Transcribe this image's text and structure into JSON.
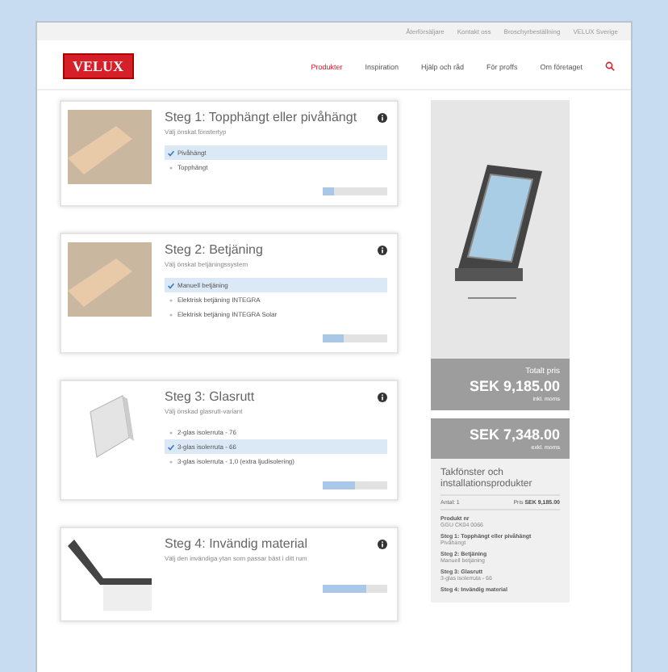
{
  "utility_links": [
    "Återförsäljare",
    "Kontakt oss",
    "Broschyrbeställning",
    "VELUX Sverige"
  ],
  "logo": "VELUX",
  "nav": [
    {
      "label": "Produkter",
      "selected": true
    },
    {
      "label": "Inspiration",
      "selected": false
    },
    {
      "label": "Hjälp och råd",
      "selected": false
    },
    {
      "label": "För proffs",
      "selected": false
    },
    {
      "label": "Om företaget",
      "selected": false
    }
  ],
  "steps": [
    {
      "title": "Steg 1: Topphängt eller pivåhängt",
      "subtitle": "Välj önskat fönstertyp",
      "kind": "hand",
      "level": 0.17,
      "options": [
        {
          "label": "Pivåhängt",
          "selected": true
        },
        {
          "label": "Topphängt",
          "selected": false
        }
      ]
    },
    {
      "title": "Steg 2: Betjäning",
      "subtitle": "Välj önskat betjäningssystem",
      "kind": "hand",
      "level": 0.33,
      "options": [
        {
          "label": "Manuell betjäning",
          "selected": true
        },
        {
          "label": "Elektrisk betjäning INTEGRA",
          "selected": false
        },
        {
          "label": "Elektrisk betjäning INTEGRA Solar",
          "selected": false
        }
      ]
    },
    {
      "title": "Steg 3: Glasrutt",
      "subtitle": "Välj önskad glasrutt-variant",
      "kind": "pane",
      "level": 0.5,
      "options": [
        {
          "label": "2-glas isolerruta - 76",
          "selected": false
        },
        {
          "label": "3-glas isolerruta - 66",
          "selected": true
        },
        {
          "label": "3-glas isolerruta - 1,0 (extra ljudisolering)",
          "selected": false
        }
      ]
    },
    {
      "title": "Steg 4: Invändig material",
      "subtitle": "Välj den invändiga ytan som passar bäst i ditt rum",
      "kind": "frame",
      "level": 0.67
    }
  ],
  "summary": {
    "total_label": "Totalt pris",
    "total": "SEK 9,185.00",
    "total_note": "inkl. moms",
    "price2": "SEK 7,348.00",
    "price2_note": "exkl. moms",
    "heading": "Takfönster och installationsprodukter",
    "qty": "Antal: 1",
    "qty_price_label": "Pris",
    "qty_price": "SEK 9,185.00",
    "lines": [
      {
        "title": "Produkt nr",
        "value": "GGU CK04 0066"
      },
      {
        "title": "Steg 1: Topphängt eller pivåhängt",
        "value": "Pivåhängt"
      },
      {
        "title": "Steg 2: Betjäning",
        "value": "Manuell betjäning"
      },
      {
        "title": "Steg 3: Glasrutt",
        "value": "3-glas isolerruta - 66"
      },
      {
        "title": "Steg 4: Invändig material"
      }
    ]
  }
}
